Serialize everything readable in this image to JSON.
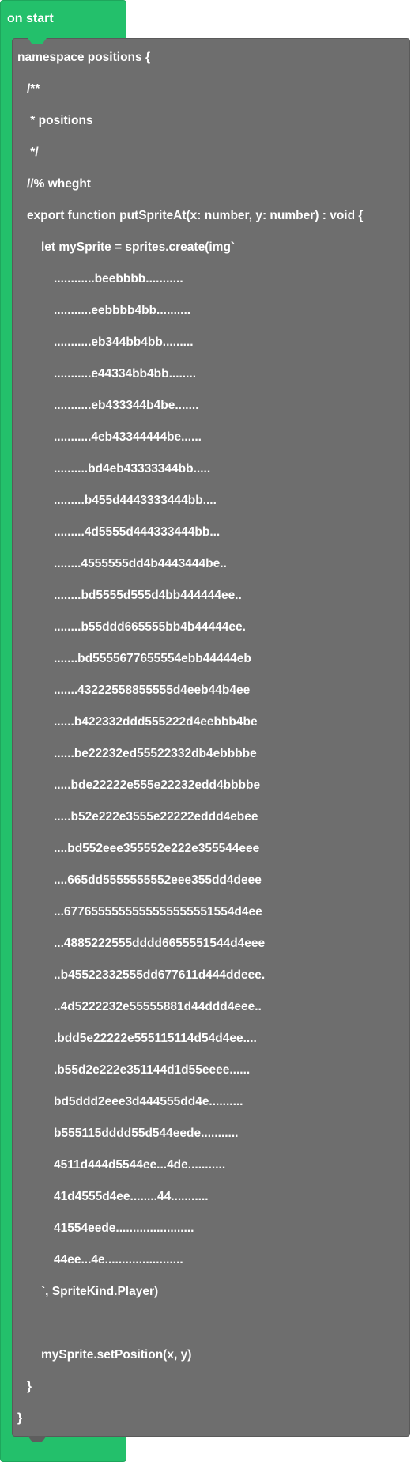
{
  "event_block": {
    "label": "on start"
  },
  "code_lines": [
    "namespace positions {",
    "/**",
    " * positions",
    " */",
    "//% wheght",
    "export function putSpriteAt(x: number, y: number) : void {",
    "let mySprite = sprites.create(img`",
    "............beebbbb...........",
    "...........eebbbb4bb..........",
    "...........eb344bb4bb.........",
    "...........e44334bb4bb........",
    "...........eb433344b4be.......",
    "...........4eb43344444be......",
    "..........bd4eb43333344bb.....",
    ".........b455d4443333444bb....",
    ".........4d5555d444333444bb...",
    "........4555555dd4b4443444be..",
    "........bd5555d555d4bb444444ee..",
    "........b55ddd665555bb4b44444ee.",
    ".......bd5555677655554ebb44444eb",
    ".......43222558855555d4eeb44b4ee",
    "......b422332ddd555222d4eebbb4be",
    "......be22232ed55522332db4ebbbbe",
    ".....bde22222e555e22232edd4bbbbe",
    ".....b52e222e3555e22222eddd4ebee",
    "....bd552eee355552e222e355544eee",
    "....665dd5555555552eee355dd4deee",
    "...6776555555555555555551554d4ee",
    "...4885222555dddd6655551544d4eee",
    "..b45522332555dd677611d444ddeee.",
    "..4d5222232e55555881d44ddd4eee..",
    ".bdd5e22222e555115114d54d4ee....",
    ".b55d2e222e351144d1d55eeee......",
    "bd5ddd2eee3d444555dd4e..........",
    "b555115dddd55d544eede...........",
    "4511d444d5544ee...4de...........",
    "41d4555d4ee........44...........",
    "41554eede.......................",
    "44ee...4e.......................",
    "`, SpriteKind.Player)",
    "",
    "mySprite.setPosition(x, y)",
    "}",
    "}"
  ],
  "colors": {
    "event_block": "#23c06b",
    "code_block": "#6e6e6e",
    "text": "#ffffff"
  }
}
